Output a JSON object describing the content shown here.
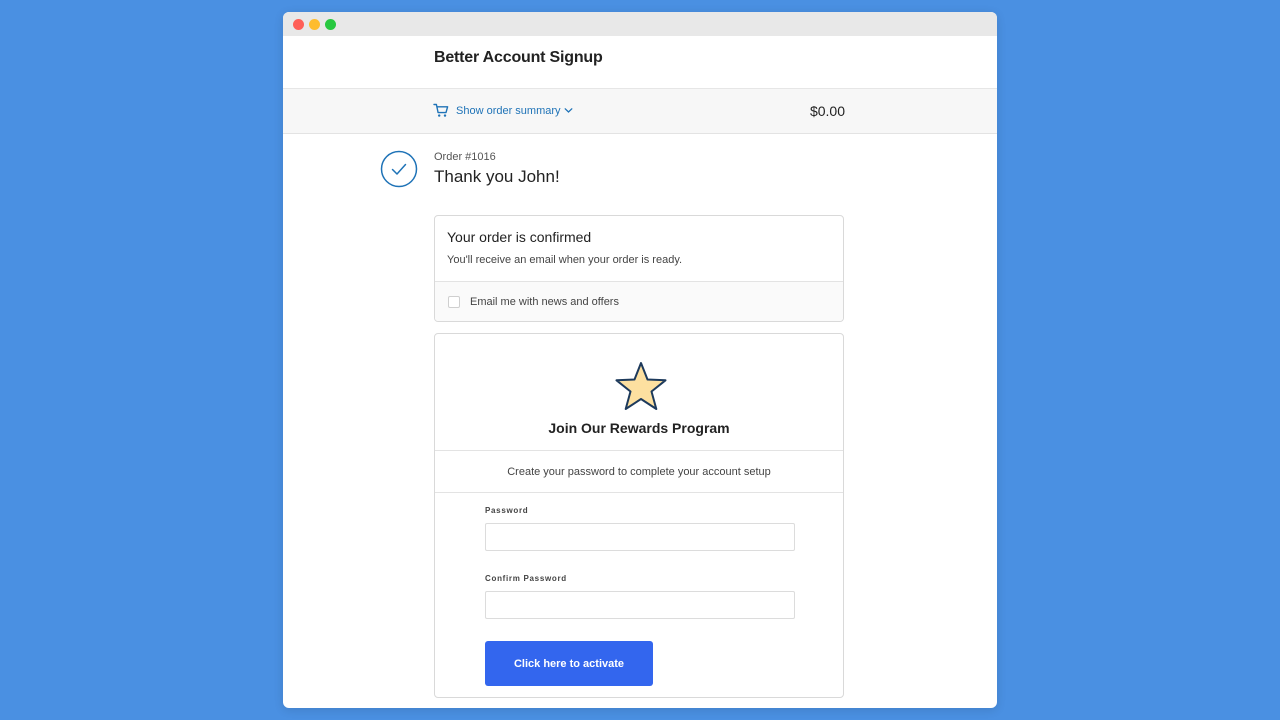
{
  "store": {
    "title": "Better Account Signup"
  },
  "order_summary": {
    "toggle_label": "Show order summary",
    "total": "$0.00"
  },
  "order": {
    "number": "Order #1016",
    "thank_you": "Thank you John!"
  },
  "confirmation": {
    "title": "Your order is confirmed",
    "description": "You'll receive an email when your order is ready.",
    "newsletter_label": "Email me with news and offers",
    "newsletter_checked": false
  },
  "rewards": {
    "title": "Join Our Rewards Program",
    "subtitle": "Create your password to complete your account setup",
    "password_label": "Password",
    "password_value": "",
    "confirm_label": "Confirm Password",
    "confirm_value": "",
    "button_label": "Click here to activate"
  },
  "icons": {
    "cart": "cart-icon",
    "chevron": "chevron-down-icon",
    "check": "check-circle-icon",
    "star": "star-icon"
  },
  "colors": {
    "page_background": "#4a90e2",
    "link": "#1f73b7",
    "button": "#3366ee",
    "star_fill": "#fde0a0",
    "star_stroke": "#1d3a5c"
  }
}
